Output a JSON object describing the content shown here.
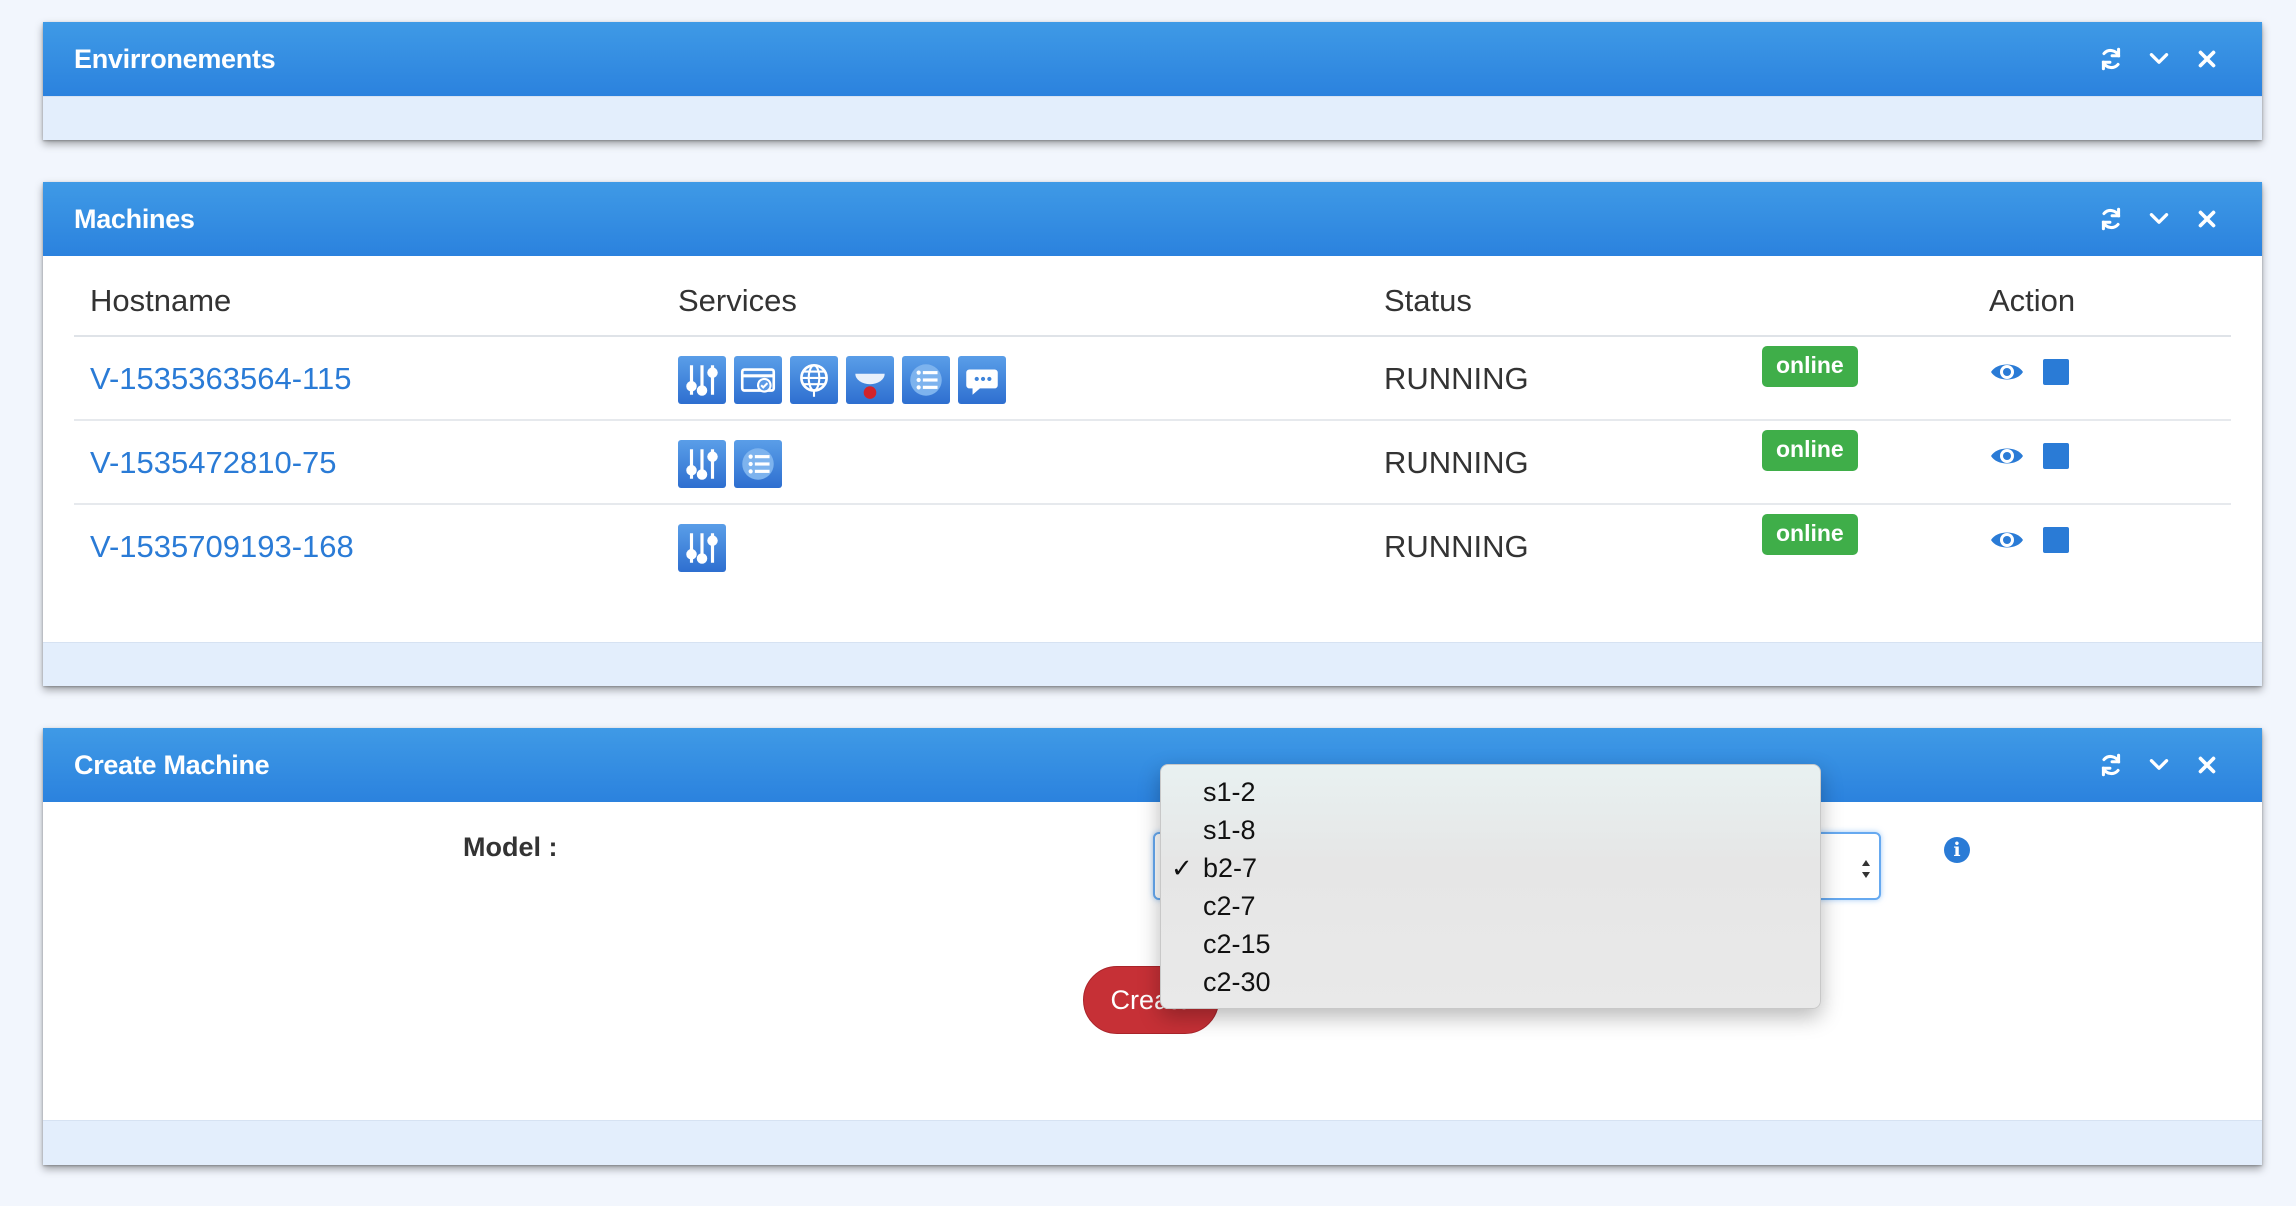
{
  "panels": {
    "environments": {
      "title": "Envirronements"
    },
    "machines": {
      "title": "Machines"
    },
    "create": {
      "title": "Create Machine"
    }
  },
  "tools": [
    "refresh-icon",
    "chevron-down-icon",
    "close-icon"
  ],
  "machines": {
    "columns": {
      "hostname": "Hostname",
      "services": "Services",
      "status": "Status",
      "action": "Action"
    },
    "rows": [
      {
        "hostname": "V-1535363564-115",
        "status": "RUNNING",
        "badge": "online",
        "services": [
          "sliders-icon",
          "card-icon",
          "globe-icon",
          "cloud-icon",
          "list-icon",
          "chat-icon"
        ]
      },
      {
        "hostname": "V-1535472810-75",
        "status": "RUNNING",
        "badge": "online",
        "services": [
          "sliders-icon",
          "list-icon"
        ]
      },
      {
        "hostname": "V-1535709193-168",
        "status": "RUNNING",
        "badge": "online",
        "services": [
          "sliders-icon"
        ]
      }
    ]
  },
  "create": {
    "model_label": "Model :",
    "button_label": "Create",
    "options": [
      "s1-2",
      "s1-8",
      "b2-7",
      "c2-7",
      "c2-15",
      "c2-30"
    ],
    "selected": "b2-7",
    "check_mark": "✓"
  },
  "colors": {
    "header": "#2b82de",
    "badge": "#3fae49",
    "link": "#2a7bd6",
    "button": "#c63036"
  }
}
